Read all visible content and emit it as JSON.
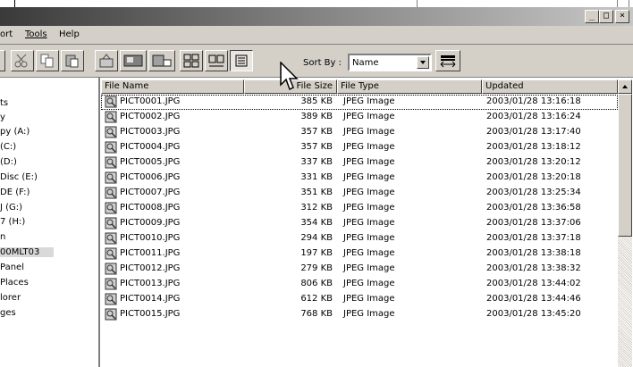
{
  "window": {
    "minimize_label": "_",
    "maximize_label": "□",
    "close_label": "×"
  },
  "menu": {
    "items": [
      "ort",
      "Tools",
      "Help"
    ]
  },
  "toolbar": {
    "sort_label": "Sort By :",
    "sort_value": "Name",
    "buttons": [
      "cut-icon",
      "copy-icon",
      "paste-icon",
      "move-to-folder-icon",
      "slideshow-icon",
      "print-icon",
      "thumbnails-view-icon",
      "details-view-icon",
      "list-view-icon",
      "sort-order-icon"
    ]
  },
  "tree": {
    "items": [
      "ts",
      "y",
      "py (A:)",
      " (C:)",
      " (D:)",
      " Disc (E:)",
      "DE (F:)",
      "J (G:)",
      "7 (H:)",
      "n",
      "00MLT03",
      "Panel",
      "Places",
      "lorer",
      "ges"
    ],
    "selected_index": 10
  },
  "list": {
    "columns": {
      "name": "File Name",
      "size": "File Size",
      "type": "File Type",
      "updated": "Updated"
    },
    "rows": [
      {
        "name": "PICT0001.JPG",
        "size": "385 KB",
        "type": "JPEG Image",
        "updated": "2003/01/28 13:16:18"
      },
      {
        "name": "PICT0002.JPG",
        "size": "389 KB",
        "type": "JPEG Image",
        "updated": "2003/01/28 13:16:24"
      },
      {
        "name": "PICT0003.JPG",
        "size": "357 KB",
        "type": "JPEG Image",
        "updated": "2003/01/28 13:17:40"
      },
      {
        "name": "PICT0004.JPG",
        "size": "357 KB",
        "type": "JPEG Image",
        "updated": "2003/01/28 13:18:12"
      },
      {
        "name": "PICT0005.JPG",
        "size": "337 KB",
        "type": "JPEG Image",
        "updated": "2003/01/28 13:20:12"
      },
      {
        "name": "PICT0006.JPG",
        "size": "331 KB",
        "type": "JPEG Image",
        "updated": "2003/01/28 13:20:18"
      },
      {
        "name": "PICT0007.JPG",
        "size": "351 KB",
        "type": "JPEG Image",
        "updated": "2003/01/28 13:25:34"
      },
      {
        "name": "PICT0008.JPG",
        "size": "312 KB",
        "type": "JPEG Image",
        "updated": "2003/01/28 13:36:58"
      },
      {
        "name": "PICT0009.JPG",
        "size": "354 KB",
        "type": "JPEG Image",
        "updated": "2003/01/28 13:37:06"
      },
      {
        "name": "PICT0010.JPG",
        "size": "294 KB",
        "type": "JPEG Image",
        "updated": "2003/01/28 13:37:18"
      },
      {
        "name": "PICT0011.JPG",
        "size": "197 KB",
        "type": "JPEG Image",
        "updated": "2003/01/28 13:38:18"
      },
      {
        "name": "PICT0012.JPG",
        "size": "279 KB",
        "type": "JPEG Image",
        "updated": "2003/01/28 13:38:32"
      },
      {
        "name": "PICT0013.JPG",
        "size": "806 KB",
        "type": "JPEG Image",
        "updated": "2003/01/28 13:44:02"
      },
      {
        "name": "PICT0014.JPG",
        "size": "612 KB",
        "type": "JPEG Image",
        "updated": "2003/01/28 13:44:46"
      },
      {
        "name": "PICT0015.JPG",
        "size": "768 KB",
        "type": "JPEG Image",
        "updated": "2003/01/28 13:45:20"
      }
    ]
  }
}
